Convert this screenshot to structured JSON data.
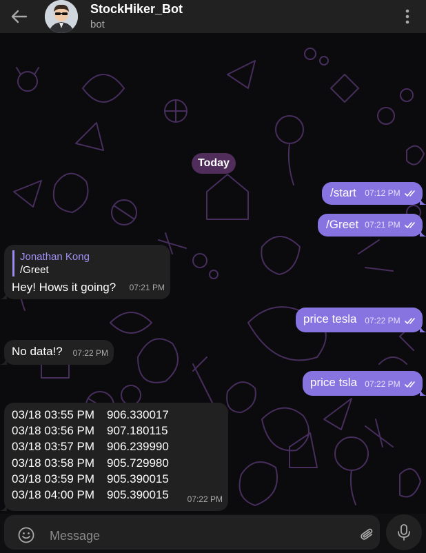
{
  "header": {
    "back_icon": "arrow-left-icon",
    "title": "StockHiker_Bot",
    "subtitle": "bot",
    "more_icon": "vertical-dots-icon"
  },
  "chat": {
    "date_divider": "Today",
    "messages": [
      {
        "direction": "outgoing",
        "text": "/start",
        "time": "07:12 PM",
        "status": "read"
      },
      {
        "direction": "outgoing",
        "text": "/Greet",
        "time": "07:21 PM",
        "status": "read"
      },
      {
        "direction": "incoming",
        "reply_to": {
          "name": "Jonathan Kong",
          "text": "/Greet"
        },
        "text": "Hey! Hows it going?",
        "time": "07:21 PM"
      },
      {
        "direction": "outgoing",
        "text": "price tesla",
        "time": "07:22 PM",
        "status": "read"
      },
      {
        "direction": "incoming",
        "text": "No data!?",
        "time": "07:22 PM"
      },
      {
        "direction": "outgoing",
        "text": "price tsla",
        "time": "07:22 PM",
        "status": "read"
      },
      {
        "direction": "incoming",
        "time": "07:22 PM",
        "rows": [
          {
            "time": "03/18 03:55 PM",
            "price": "906.330017"
          },
          {
            "time": "03/18 03:56 PM",
            "price": "907.180115"
          },
          {
            "time": "03/18 03:57 PM",
            "price": "906.239990"
          },
          {
            "time": "03/18 03:58 PM",
            "price": "905.729980"
          },
          {
            "time": "03/18 03:59 PM",
            "price": "905.390015"
          },
          {
            "time": "03/18 04:00 PM",
            "price": "905.390015"
          }
        ]
      }
    ]
  },
  "composer": {
    "placeholder": "Message",
    "emoji_icon": "smiley-icon",
    "attach_icon": "paperclip-icon",
    "mic_icon": "microphone-icon"
  },
  "colors": {
    "accent": "#8774e1",
    "header_bg": "#212121",
    "incoming_bg": "#212121",
    "background": "#0b0b0e",
    "doodle": "#5b3a78",
    "reply_name": "#9f90f5"
  }
}
